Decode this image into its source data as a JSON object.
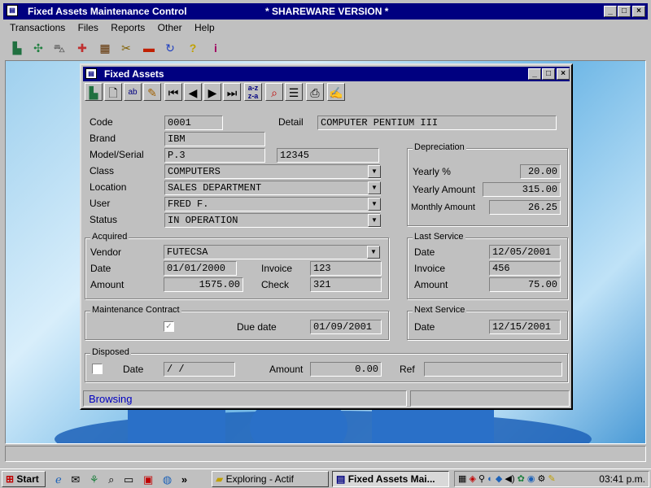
{
  "main_window": {
    "title": "Fixed Assets Maintenance Control",
    "version": "* SHAREWARE VERSION *",
    "menu": [
      "Transactions",
      "Files",
      "Reports",
      "Other",
      "Help"
    ],
    "toolbar_icons": [
      "computer-icon",
      "plant-icon",
      "car-icon",
      "ambulance-icon",
      "building-icon",
      "tools-icon",
      "card-icon",
      "refresh-icon",
      "help-icon",
      "info-icon"
    ]
  },
  "dialog": {
    "title": "Fixed Assets",
    "labels": {
      "code": "Code",
      "detail": "Detail",
      "brand": "Brand",
      "model": "Model/Serial",
      "class": "Class",
      "location": "Location",
      "user": "User",
      "status": "Status"
    },
    "values": {
      "code": "0001",
      "detail": "COMPUTER PENTIUM III",
      "brand": "IBM",
      "model": "P.3",
      "serial": "12345",
      "class": "COMPUTERS",
      "location": "SALES DEPARTMENT",
      "user": "FRED F.",
      "status": "IN OPERATION"
    },
    "depreciation": {
      "title": "Depreciation",
      "yearly_pct_label": "Yearly %",
      "yearly_pct": "20.00",
      "yearly_amount_label": "Yearly Amount",
      "yearly_amount": "315.00",
      "monthly_amount_label": "Monthly Amount",
      "monthly_amount": "26.25"
    },
    "acquired": {
      "title": "Acquired",
      "vendor_label": "Vendor",
      "vendor": "FUTECSA",
      "date_label": "Date",
      "date": "01/01/2000",
      "invoice_label": "Invoice",
      "invoice": "123",
      "amount_label": "Amount",
      "amount": "1575.00",
      "check_label": "Check",
      "check": "321"
    },
    "last_service": {
      "title": "Last Service",
      "date_label": "Date",
      "date": "12/05/2001",
      "invoice_label": "Invoice",
      "invoice": "456",
      "amount_label": "Amount",
      "amount": "75.00"
    },
    "maintenance": {
      "title": "Maintenance Contract",
      "due_label": "Due date",
      "due": "01/09/2001"
    },
    "next_service": {
      "title": "Next Service",
      "date_label": "Date",
      "date": "12/15/2001"
    },
    "disposed": {
      "title": "Disposed",
      "date_label": "Date",
      "date": " /  /",
      "amount_label": "Amount",
      "amount": "0.00",
      "ref_label": "Ref",
      "ref": ""
    },
    "status_text": "Browsing"
  },
  "taskbar": {
    "start": "Start",
    "chevron": "»",
    "tasks": [
      "Exploring - Actif",
      "Fixed Assets Mai..."
    ],
    "clock": "03:41 p.m."
  },
  "colors": {
    "titlebar": "#000080",
    "status_text": "#0000c0"
  }
}
